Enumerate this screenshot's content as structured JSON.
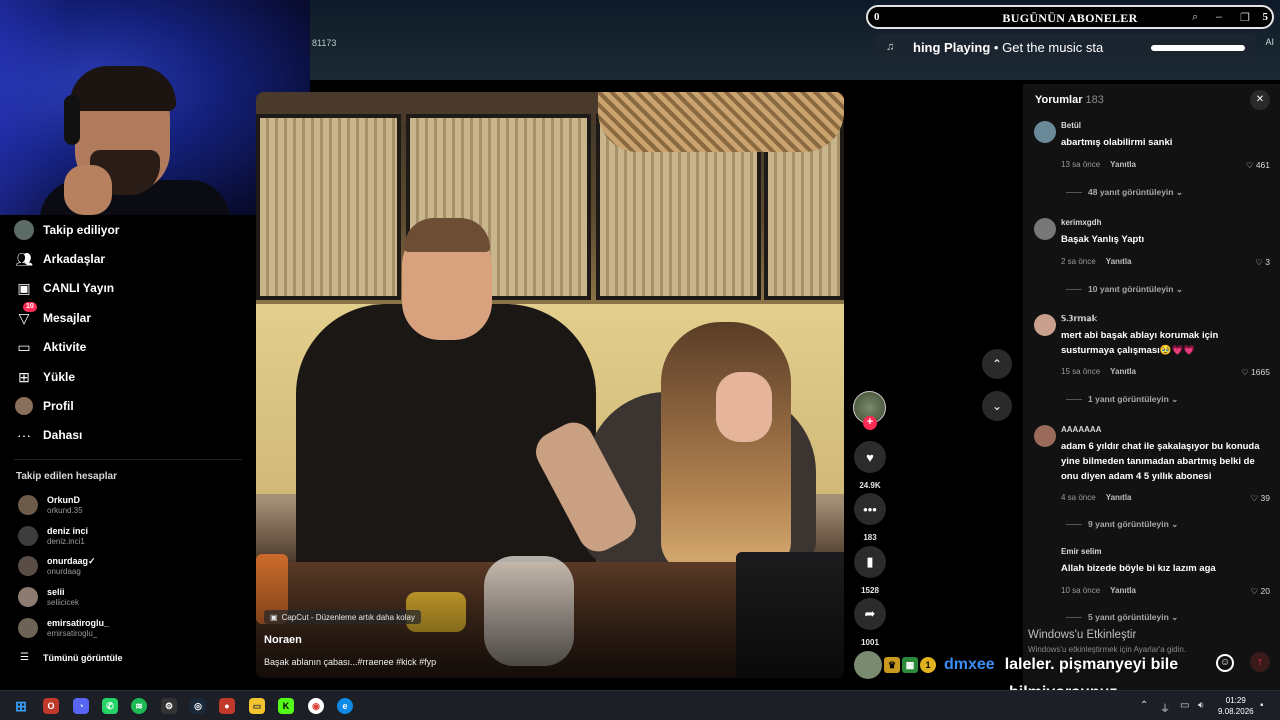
{
  "header": {
    "id_fragment": "81173",
    "subscribers_left": "0",
    "subscribers_title": "BUGÜNÜN ABONELER",
    "subscribers_right": "5",
    "now_playing_title": "hing Playing",
    "now_playing_sep": "•",
    "now_playing_sub": "Get the music sta",
    "ai_tag": "AI"
  },
  "sidebar": {
    "items": [
      {
        "label": "Takip ediliyor",
        "icon": "following-avatar-icon"
      },
      {
        "label": "Arkadaşlar",
        "icon": "friends-icon"
      },
      {
        "label": "CANLI Yayın",
        "icon": "live-icon"
      },
      {
        "label": "Mesajlar",
        "icon": "messages-icon",
        "badge": "10"
      },
      {
        "label": "Aktivite",
        "icon": "activity-icon"
      },
      {
        "label": "Yükle",
        "icon": "upload-icon"
      },
      {
        "label": "Profil",
        "icon": "profile-icon"
      },
      {
        "label": "Dahası",
        "icon": "more-icon"
      }
    ],
    "followed_header": "Takip edilen hesaplar",
    "accounts": [
      {
        "name": "OrkunD",
        "handle": "orkund.35"
      },
      {
        "name": "deniz inci",
        "handle": "deniz.inci1"
      },
      {
        "name": "onurdaag✓",
        "handle": "onurdaag"
      },
      {
        "name": "selii",
        "handle": "seliicicek"
      },
      {
        "name": "emirsatiroglu_",
        "handle": "emirsatiroglu_"
      }
    ],
    "see_all": "Tümünü görüntüle"
  },
  "video": {
    "capcut": "CapCut - Düzenleme artık daha kolay",
    "author": "Noraen",
    "caption": "Başak ablanın çabası...#rraenee #kick #fyp"
  },
  "actions": {
    "likes": "24.9K",
    "comments": "183",
    "saves": "1528",
    "shares": "1001"
  },
  "comments": {
    "title": "Yorumlar",
    "count": "183",
    "items": [
      {
        "user": "Betül",
        "text": "abartmış olabilirmi sanki",
        "time": "13 sa önce",
        "reply": "Yanıtla",
        "likes": "461",
        "replies": "48 yanıt görüntüleyin"
      },
      {
        "user": "kerimxgdh",
        "text": "Başak Yanlış Yaptı",
        "time": "2 sa önce",
        "reply": "Yanıtla",
        "likes": "3",
        "replies": "10 yanıt görüntüleyin"
      },
      {
        "user": "𝕊.𝟛𝕣𝕞𝕒𝕜",
        "text": "mert abi başak ablayı korumak için susturmaya çalışması🥹💗💗",
        "time": "15 sa önce",
        "reply": "Yanıtla",
        "likes": "1665",
        "replies": "1 yanıt görüntüleyin"
      },
      {
        "user": "AAAAAAA",
        "text": "adam 6 yıldır chat ile şakalaşıyor bu konuda yine bilmeden tanımadan abartmış belki de onu diyen adam 4 5 yıllık abonesi",
        "time": "4 sa önce",
        "reply": "Yanıtla",
        "likes": "39",
        "replies": "9 yanıt görüntüleyin"
      },
      {
        "user": "Emir selim",
        "text": "Allah bizede böyle bi kız lazım aga",
        "time": "10 sa önce",
        "reply": "Yanıtla",
        "likes": "20",
        "replies": "5 yanıt görüntüleyin"
      }
    ]
  },
  "watermark": {
    "title": "Windows'u Etkinleştir",
    "sub": "Windows'u etkinleştirmek için Ayarlar'a gidin."
  },
  "chat": {
    "badge_num": "1",
    "user": "dmxee",
    "message_line1": "laleler. pişmanyeyi bile",
    "message_line2": "bilmiyorsunuz"
  },
  "taskbar": {
    "time": "01:29",
    "date": "9.08.2026"
  }
}
